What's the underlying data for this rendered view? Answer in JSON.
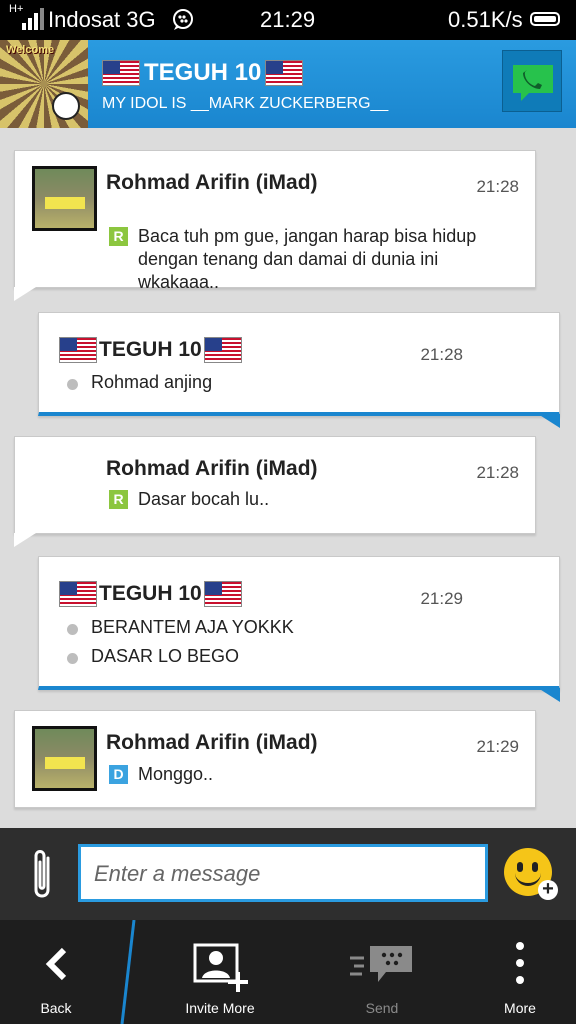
{
  "status_bar": {
    "network_type": "H+",
    "carrier": "Indosat 3G",
    "time": "21:29",
    "speed": "0.51K/s"
  },
  "header": {
    "avatar_text": "Welcome",
    "contact_name": "TEGUH 10",
    "status_message": "MY IDOL IS __MARK ZUCKERBERG__",
    "call_icon": "phone-icon"
  },
  "messages": [
    {
      "direction": "in",
      "sender": "Rohmad Arifin (iMad)",
      "time": "21:28",
      "has_avatar": true,
      "badge": "R",
      "lines": [
        "Baca tuh pm gue, jangan harap bisa hidup",
        "dengan tenang dan damai di dunia ini",
        "wkakaaa.."
      ]
    },
    {
      "direction": "out",
      "sender": "TEGUH 10",
      "time": "21:28",
      "lines": [
        "Rohmad anjing"
      ]
    },
    {
      "direction": "in",
      "sender": "Rohmad Arifin (iMad)",
      "time": "21:28",
      "has_avatar": false,
      "badge": "R",
      "lines": [
        "Dasar bocah lu.."
      ]
    },
    {
      "direction": "out",
      "sender": "TEGUH 10",
      "time": "21:29",
      "lines": [
        "BERANTEM AJA YOKKK",
        "DASAR LO BEGO"
      ]
    },
    {
      "direction": "in",
      "sender": "Rohmad Arifin (iMad)",
      "time": "21:29",
      "has_avatar": true,
      "badge": "D",
      "lines": [
        "Monggo.."
      ]
    }
  ],
  "composer": {
    "placeholder": "Enter a message"
  },
  "bottom_bar": {
    "back": "Back",
    "invite": "Invite More",
    "send": "Send",
    "more": "More"
  },
  "colors": {
    "accent": "#2A9BE0",
    "header_bg": "#1A86CF",
    "read_badge": "#8CC63F",
    "delivered_badge": "#3BA3E0"
  }
}
